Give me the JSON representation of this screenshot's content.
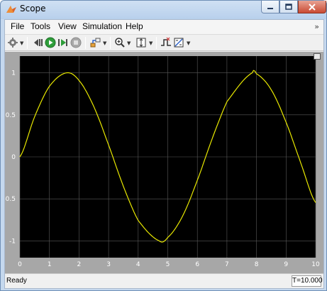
{
  "window": {
    "title": "Scope",
    "icon": "matlab-scope-icon"
  },
  "menu": {
    "items": [
      "File",
      "Tools",
      "View",
      "Simulation",
      "Help"
    ],
    "overflow_icon": "chevron-double-right-icon"
  },
  "toolbar": {
    "buttons": [
      {
        "name": "settings-gear-icon",
        "has_dropdown": true
      },
      {
        "name": "step-back-icon"
      },
      {
        "name": "run-icon"
      },
      {
        "name": "step-forward-icon"
      },
      {
        "name": "stop-icon"
      },
      {
        "name": "highlight-simulink-block-icon",
        "has_dropdown": true
      },
      {
        "name": "zoom-in-icon",
        "has_dropdown": true
      },
      {
        "name": "scale-axes-icon",
        "has_dropdown": true
      },
      {
        "name": "triggers-icon"
      },
      {
        "name": "measurements-icon",
        "has_dropdown": true
      }
    ]
  },
  "plot": {
    "undock_icon": "undock-icon",
    "colors": {
      "background": "#000000",
      "grid": "#5a5a5a",
      "trace": "#e8e800",
      "axis_text": "#ffffff",
      "frame": "#a7a7a7"
    }
  },
  "chart_data": {
    "type": "line",
    "title": "",
    "xlabel": "",
    "ylabel": "",
    "xlim": [
      0,
      10
    ],
    "ylim": [
      -1.2,
      1.2
    ],
    "x_ticks": [
      "0",
      "1",
      "2",
      "3",
      "4",
      "5",
      "6",
      "7",
      "8",
      "9",
      "10"
    ],
    "y_ticks": [
      "1",
      "0.5",
      "0",
      "-0.5",
      "-1"
    ],
    "grid": true,
    "legend": "none",
    "series": [
      {
        "color": "#e8e800",
        "x": [
          0,
          0.5,
          1,
          1.5708,
          2,
          2.5,
          3,
          3.5,
          4,
          4.7124,
          5,
          5.5,
          6,
          6.5,
          7,
          7.854,
          8,
          8.5,
          9,
          9.5,
          10
        ],
        "y": [
          0,
          0.479,
          0.841,
          1.0,
          0.909,
          0.598,
          0.141,
          -0.351,
          -0.757,
          -1.0,
          -0.959,
          -0.706,
          -0.279,
          0.215,
          0.657,
          1.0,
          0.989,
          0.798,
          0.412,
          -0.075,
          -0.544
        ]
      }
    ]
  },
  "status": {
    "text": "Ready",
    "time": "T=10.000"
  }
}
